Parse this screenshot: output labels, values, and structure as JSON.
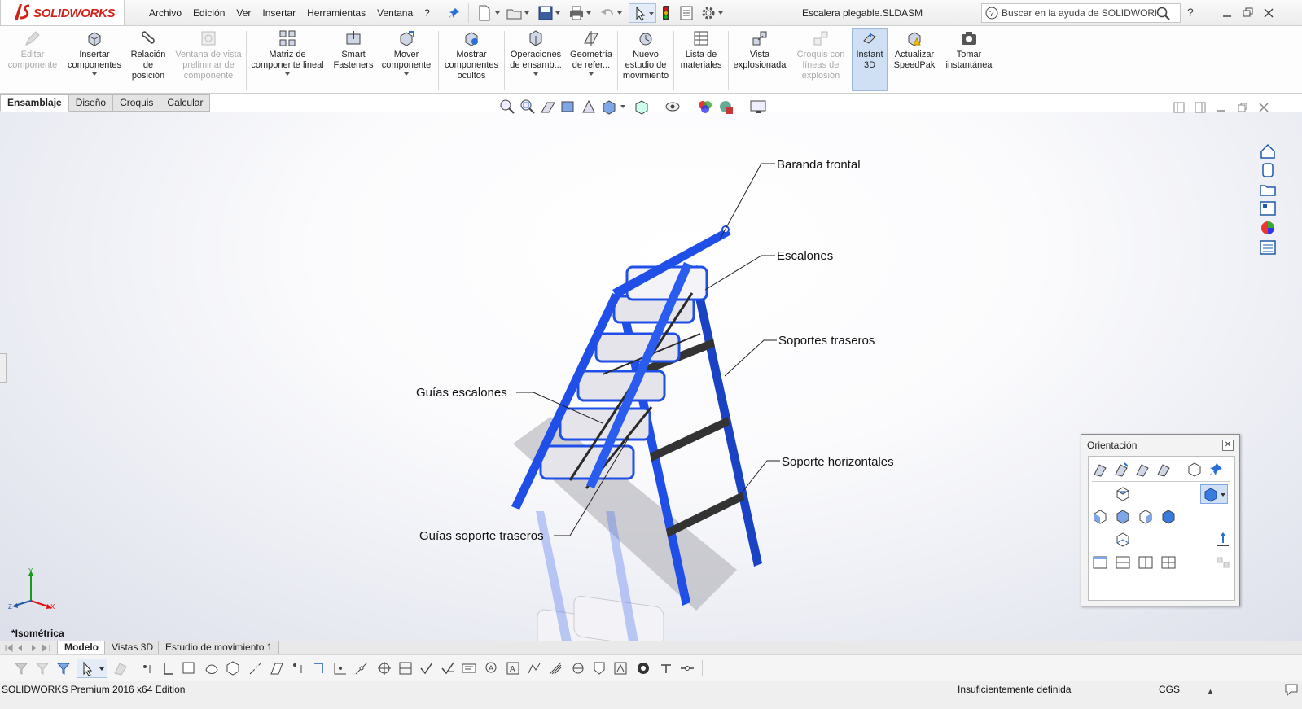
{
  "app": {
    "brand": "SOLIDWORKS",
    "document_title": "Escalera plegable.SLDASM"
  },
  "menu": [
    "Archivo",
    "Edición",
    "Ver",
    "Insertar",
    "Herramientas",
    "Ventana",
    "?"
  ],
  "search": {
    "placeholder": "Buscar en la ayuda de SOLIDWORKS"
  },
  "help_label": "?",
  "ribbon": [
    {
      "label": "Editar\ncomponente",
      "disabled": true,
      "icon": "edit-component-icon"
    },
    {
      "label": "Insertar\ncomponentes",
      "dropdown": true,
      "icon": "insert-components-icon"
    },
    {
      "label": "Relación\nde\nposición",
      "icon": "mate-icon"
    },
    {
      "label": "Ventana de vista\npreliminar de\ncomponente",
      "disabled": true,
      "icon": "preview-window-icon"
    },
    {
      "label": "Matriz de\ncomponente lineal",
      "dropdown": true,
      "icon": "linear-pattern-icon"
    },
    {
      "label": "Smart\nFasteners",
      "icon": "smart-fasteners-icon"
    },
    {
      "label": "Mover\ncomponente",
      "dropdown": true,
      "icon": "move-component-icon"
    },
    {
      "label": "Mostrar\ncomponentes\nocultos",
      "icon": "show-hidden-icon"
    },
    {
      "label": "Operaciones\nde ensamb...",
      "dropdown": true,
      "icon": "assembly-features-icon"
    },
    {
      "label": "Geometría\nde refer...",
      "dropdown": true,
      "icon": "reference-geometry-icon"
    },
    {
      "label": "Nuevo\nestudio de\nmovimiento",
      "icon": "motion-study-icon"
    },
    {
      "label": "Lista de\nmateriales",
      "icon": "bom-icon"
    },
    {
      "label": "Vista\nexplosionada",
      "icon": "exploded-view-icon"
    },
    {
      "label": "Croquis con\nlíneas de\nexplosión",
      "disabled": true,
      "icon": "explode-line-sketch-icon"
    },
    {
      "label": "Instant\n3D",
      "active": true,
      "icon": "instant-3d-icon"
    },
    {
      "label": "Actualizar\nSpeedPak",
      "icon": "speedpak-icon"
    },
    {
      "label": "Tomar\ninstantánea",
      "icon": "snapshot-icon"
    }
  ],
  "command_tabs": [
    "Ensamblaje",
    "Diseño",
    "Croquis",
    "Calcular"
  ],
  "callouts": {
    "baranda": "Baranda frontal",
    "escalones": "Escalones",
    "soportes_traseros": "Soportes traseros",
    "guias_escalones": "Guías escalones",
    "soporte_horizontales": "Soporte horizontales",
    "guias_soporte": "Guías soporte traseros"
  },
  "view_name": "*Isométrica",
  "orientation": {
    "title": "Orientación"
  },
  "bottom_tabs": [
    "Modelo",
    "Vistas 3D",
    "Estudio de movimiento 1"
  ],
  "status": {
    "edition": "SOLIDWORKS Premium 2016 x64 Edition",
    "definition": "Insuficientemente definida",
    "units": "CGS"
  },
  "colors": {
    "accent": "#d1221b",
    "frame": "#1f4fe6",
    "brace": "#333333"
  }
}
